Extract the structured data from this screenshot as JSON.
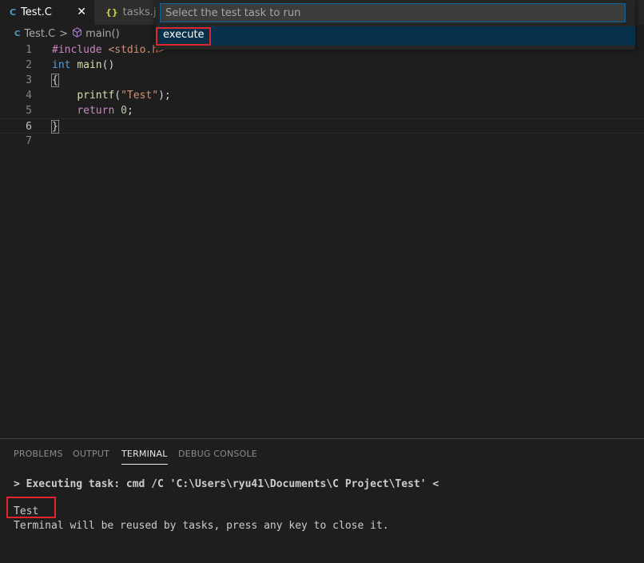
{
  "tabs": [
    {
      "icon": "C",
      "label": "Test.C",
      "close": "✕"
    },
    {
      "icon": "{}",
      "label": "tasks.jsc"
    }
  ],
  "breadcrumb": {
    "file": "Test.C",
    "separator": ">",
    "symbol": "main()"
  },
  "quick_pick": {
    "placeholder": "Select the test task to run",
    "items": [
      {
        "label": "execute"
      }
    ]
  },
  "editor": {
    "line_numbers": [
      "1",
      "2",
      "3",
      "4",
      "5",
      "6",
      "7"
    ],
    "lines": {
      "l1": {
        "pre": "#include ",
        "str": "<stdio.h>"
      },
      "l2": {
        "type": "int ",
        "fn": "main",
        "rest": "()"
      },
      "l3": {
        "brace": "{"
      },
      "l4": {
        "indent": "    ",
        "fn": "printf",
        "open": "(",
        "str": "\"Test\"",
        "close": ");"
      },
      "l5": {
        "indent": "    ",
        "kw": "return ",
        "num": "0",
        "end": ";"
      },
      "l6": {
        "brace": "}"
      }
    }
  },
  "panel": {
    "tabs": [
      "PROBLEMS",
      "OUTPUT",
      "TERMINAL",
      "DEBUG CONSOLE"
    ],
    "active_tab": "TERMINAL",
    "terminal": {
      "line1": "> Executing task: cmd /C 'C:\\Users\\ryu41\\Documents\\C Project\\Test' <",
      "line2": "Test",
      "line3": "Terminal will be reused by tasks, press any key to close it."
    }
  },
  "colors": {
    "accent": "#0e639c",
    "highlight_box": "#e0262b",
    "selection": "#062f4a"
  }
}
